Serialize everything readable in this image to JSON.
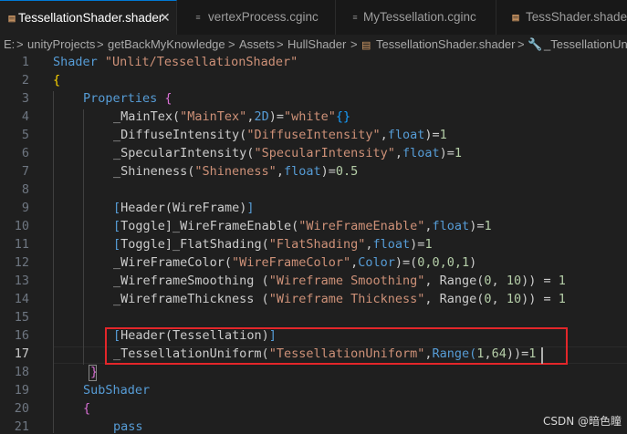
{
  "tabs": [
    {
      "label": "TessellationShader.shader",
      "close": "✕",
      "icon": "shader-file-icon",
      "active": true
    },
    {
      "label": "vertexProcess.cginc",
      "icon": "cginc-file-icon",
      "active": false
    },
    {
      "label": "MyTessellation.cginc",
      "icon": "cginc-file-icon",
      "active": false
    },
    {
      "label": "TessShader.shader",
      "icon": "shader-file-icon",
      "active": false
    }
  ],
  "breadcrumb": {
    "items": [
      "E:",
      "unityProjects",
      "getBackMyKnowledge",
      "Assets",
      "HullShader",
      "TessellationShader.shader",
      "_TessellationUni"
    ],
    "separator": ">"
  },
  "editor": {
    "line_numbers": [
      "1",
      "2",
      "3",
      "4",
      "5",
      "6",
      "7",
      "8",
      "9",
      "10",
      "11",
      "12",
      "13",
      "14",
      "15",
      "16",
      "17",
      "18",
      "19",
      "20",
      "21"
    ],
    "current_line": "17",
    "colors": {
      "keyword": "#569cd6",
      "string": "#ce9178",
      "number": "#b5cea8",
      "highlight_box": "#e3262a"
    },
    "lines": [
      [
        "Shader ",
        "\"Unlit/TessellationShader\""
      ],
      [
        "{"
      ],
      [
        "Properties ",
        "{"
      ],
      [
        "_MainTex(",
        "\"MainTex\"",
        ",",
        "2D",
        ")=",
        "\"white\"",
        "{}"
      ],
      [
        "_DiffuseIntensity(",
        "\"DiffuseIntensity\"",
        ",",
        "float",
        ")=",
        "1"
      ],
      [
        "_SpecularIntensity(",
        "\"SpecularIntensity\"",
        ",",
        "float",
        ")=",
        "1"
      ],
      [
        "_Shineness(",
        "\"Shineness\"",
        ",",
        "float",
        ")=",
        "0.5"
      ],
      [
        ""
      ],
      [
        "[",
        "Header",
        "(WireFrame)",
        "]"
      ],
      [
        "[",
        "Toggle",
        "]_WireFrameEnable(",
        "\"WireFrameEnable\"",
        ",",
        "float",
        ")=",
        "1"
      ],
      [
        "[",
        "Toggle",
        "]_FlatShading(",
        "\"FlatShading\"",
        ",",
        "float",
        ")=",
        "1"
      ],
      [
        "_WireFrameColor(",
        "\"WireFrameColor\"",
        ",",
        "Color",
        ")=(",
        "0,0,0,1",
        ")"
      ],
      [
        "_WireframeSmoothing (",
        "\"Wireframe Smoothing\"",
        ", Range(",
        "0",
        ", ",
        "10",
        "))",
        " = ",
        "1"
      ],
      [
        "_WireframeThickness (",
        "\"Wireframe Thickness\"",
        ", Range(",
        "0",
        ", ",
        "10",
        "))",
        " = ",
        "1"
      ],
      [
        ""
      ],
      [
        "[",
        "Header",
        "(Tessellation)",
        "]"
      ],
      [
        "_TessellationUniform(",
        "\"TessellationUniform\"",
        ",",
        "Range(",
        "1",
        ",",
        "64",
        "))",
        "=",
        "1"
      ],
      [
        "}"
      ],
      [
        "SubShader"
      ],
      [
        "{"
      ],
      [
        "pass"
      ]
    ]
  },
  "watermark": "CSDN @暗色瞳"
}
